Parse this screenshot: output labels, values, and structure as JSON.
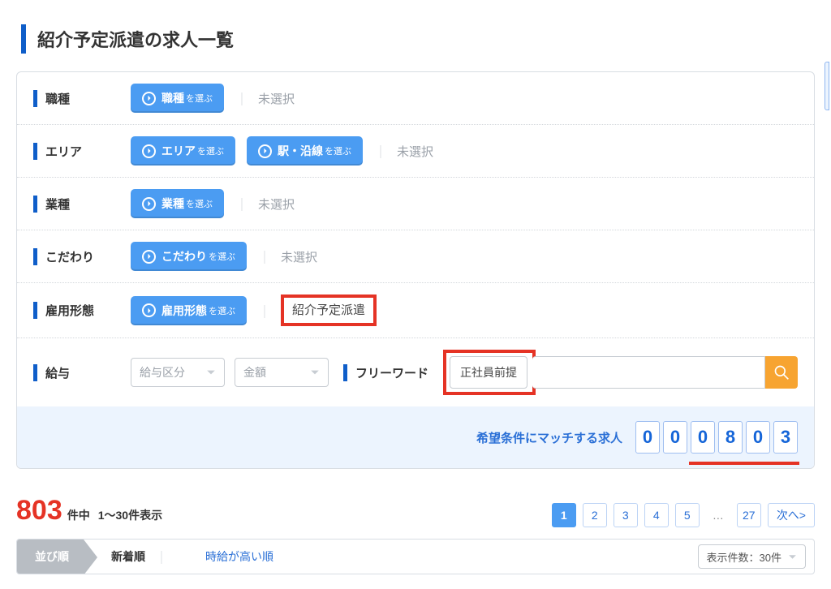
{
  "page": {
    "title": "紹介予定派遣の求人一覧"
  },
  "filters": {
    "job_type": {
      "label": "職種",
      "button_main": "職種",
      "button_sub": "を選ぶ",
      "value": "未選択",
      "placeholder": true
    },
    "area": {
      "label": "エリア",
      "button_main": "エリア",
      "button_sub": "を選ぶ",
      "button2_main": "駅・沿線",
      "button2_sub": "を選ぶ",
      "value": "未選択",
      "placeholder": true
    },
    "industry": {
      "label": "業種",
      "button_main": "業種",
      "button_sub": "を選ぶ",
      "value": "未選択",
      "placeholder": true
    },
    "preference": {
      "label": "こだわり",
      "button_main": "こだわり",
      "button_sub": "を選ぶ",
      "value": "未選択",
      "placeholder": true
    },
    "employment": {
      "label": "雇用形態",
      "button_main": "雇用形態",
      "button_sub": "を選ぶ",
      "value": "紹介予定派遣",
      "placeholder": false
    },
    "salary": {
      "label": "給与",
      "select1_placeholder": "給与区分",
      "select2_placeholder": "金額"
    },
    "freeword": {
      "label": "フリーワード",
      "value": "正社員前提"
    }
  },
  "match": {
    "label": "希望条件にマッチする求人",
    "digits": [
      "0",
      "0",
      "0",
      "8",
      "0",
      "3"
    ]
  },
  "results": {
    "total": "803",
    "unit": "件中",
    "range": "1〜30件表示"
  },
  "pager": {
    "pages": [
      "1",
      "2",
      "3",
      "4",
      "5"
    ],
    "active_index": 0,
    "ellipsis": "…",
    "last": "27",
    "next": "次へ>"
  },
  "sort": {
    "head": "並び順",
    "items": [
      {
        "label": "新着順",
        "active": true
      },
      {
        "label": "時給が高い順",
        "active": false
      }
    ],
    "per_page_label": "表示件数：30件"
  }
}
